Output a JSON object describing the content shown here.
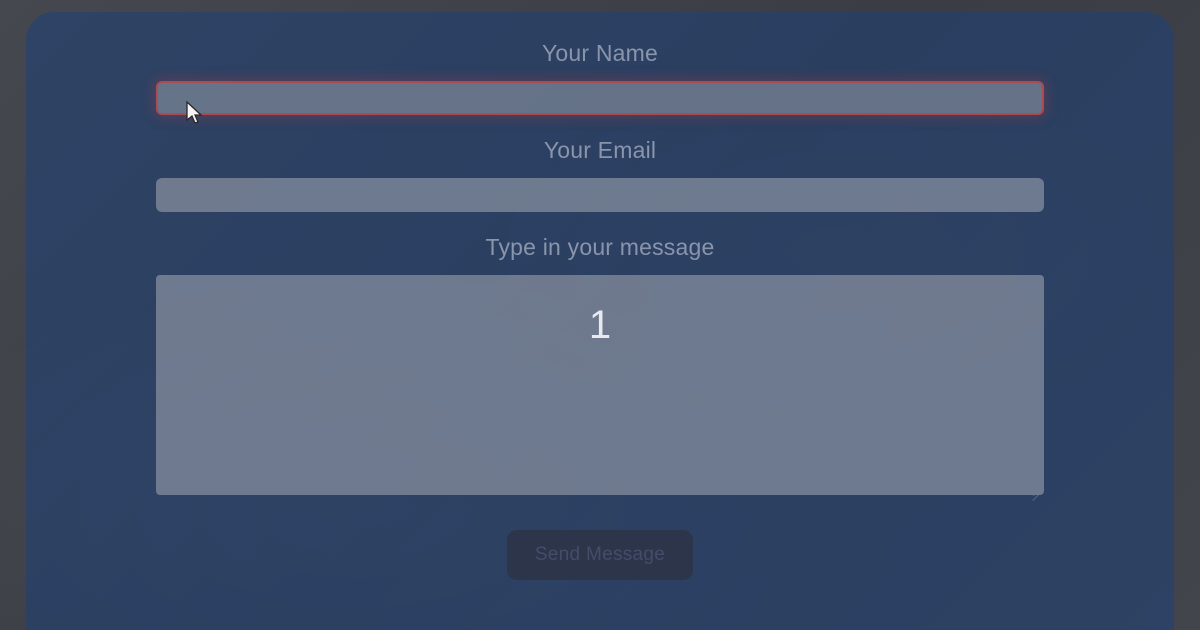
{
  "form": {
    "name_label": "Your Name",
    "name_value": "",
    "email_label": "Your Email",
    "email_value": "",
    "message_label": "Type in your message",
    "message_value": "1",
    "submit_label": "Send Message"
  }
}
